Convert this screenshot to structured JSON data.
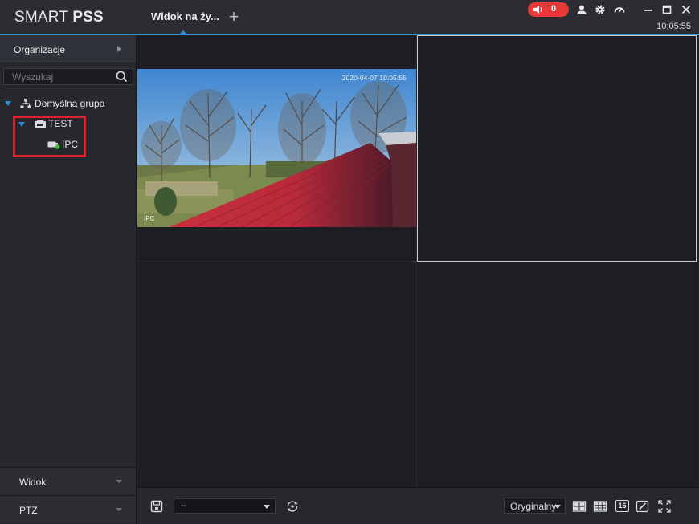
{
  "app": {
    "brand_regular": "SMART",
    "brand_bold": "PSS",
    "active_tab": "Widok na ży...",
    "add_tab": "+",
    "alarm_count": "0",
    "clock": "10:05:55"
  },
  "sidebar": {
    "org_title": "Organizacje",
    "search_placeholder": "Wyszukaj",
    "tree": {
      "root": "Domyślna grupa",
      "device": "TEST",
      "channel": "IPC"
    },
    "footer_view": "Widok",
    "footer_ptz": "PTZ"
  },
  "video": {
    "osd_time": "2020-04-07 10:05:55",
    "osd_name": "IPC"
  },
  "toolbar": {
    "layout_value": "--",
    "ratio_value": "Oryginalny",
    "grid16_label": "16"
  },
  "colors": {
    "accent": "#2b8fd6",
    "alarm": "#e8393a",
    "highlight": "#e0202a",
    "online": "#3ec43e"
  }
}
